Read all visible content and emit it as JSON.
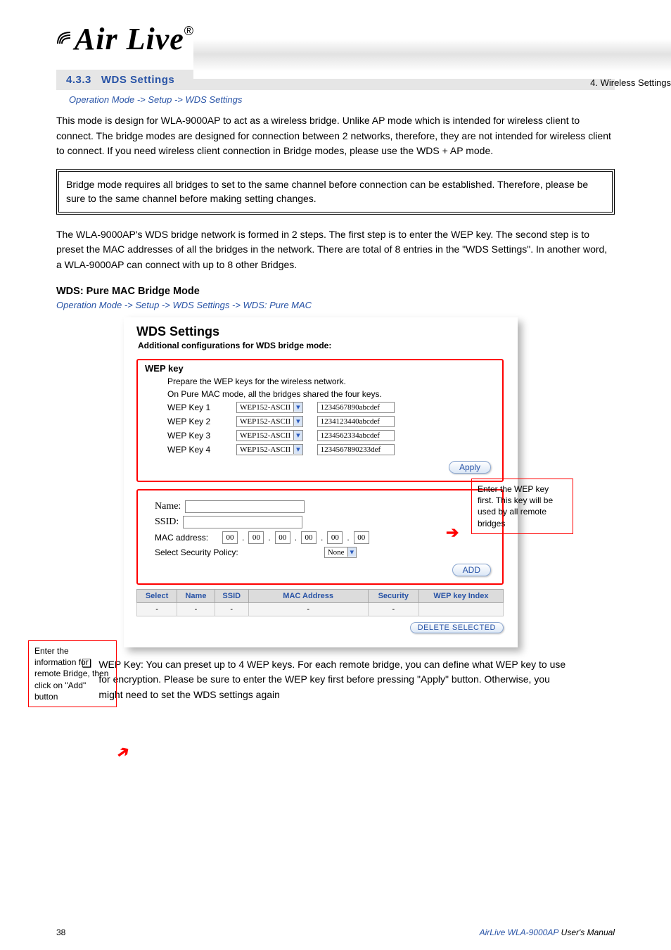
{
  "header": {
    "brand": "Air Live",
    "chapterRef": "4. Wireless Settings",
    "section_number": "4.3.3",
    "section_title": "WDS Settings",
    "crumb": "Operation Mode -> Setup -> WDS Settings"
  },
  "intro_p1": "This mode is design for WLA-9000AP to act as a wireless bridge. Unlike AP mode which is intended for wireless client to connect. The bridge modes are designed for connection between 2 networks, therefore, they are not intended for wireless client to connect. If you need wireless client connection in Bridge modes, please use the WDS + AP mode.",
  "box_text": "Bridge mode requires all bridges to set to the same channel before connection can be established. Therefore, please be sure to the same channel before making setting changes.",
  "intro_p2": "The WLA-9000AP's WDS bridge network is formed in 2 steps. The first step is to enter the WEP key. The second step is to preset the MAC addresses of all the bridges in the network. There are total of 8 entries in the \"WDS Settings\". In another word, a WLA-9000AP can connect with up to 8 other Bridges.",
  "subhead": "WDS: Pure MAC Bridge Mode",
  "subcrumb": "Operation Mode -> Setup -> WDS Settings -> WDS: Pure MAC",
  "wds_panel": {
    "title": "WDS Settings",
    "subline": "Additional configurations for WDS bridge mode:",
    "wep": {
      "heading": "WEP key",
      "desc1": "Prepare the WEP keys for the wireless network.",
      "desc2": "On Pure MAC mode, all the bridges shared the four keys.",
      "rows": [
        {
          "label": "WEP Key 1",
          "type": "WEP152-ASCII",
          "value": "1234567890abcdef"
        },
        {
          "label": "WEP Key 2",
          "type": "WEP152-ASCII",
          "value": "1234123440abcdef"
        },
        {
          "label": "WEP Key 3",
          "type": "WEP152-ASCII",
          "value": "1234562334abcdef"
        },
        {
          "label": "WEP Key 4",
          "type": "WEP152-ASCII",
          "value": "1234567890233def"
        }
      ],
      "apply": "Apply"
    },
    "add": {
      "name_label": "Name:",
      "ssid_label": "SSID:",
      "mac_label": "MAC address:",
      "mac": [
        "00",
        "00",
        "00",
        "00",
        "00",
        "00"
      ],
      "sec_label": "Select Security Policy:",
      "sec_value": "None",
      "add_btn": "ADD"
    },
    "table": {
      "headers": [
        "Select",
        "Name",
        "SSID",
        "MAC Address",
        "Security",
        "WEP key Index"
      ],
      "row": [
        "-",
        "-",
        "-",
        "-",
        "-",
        ""
      ]
    },
    "delete_btn": "DELETE SELECTED"
  },
  "callouts": {
    "right": "Enter the WEP key first. This key will be used by all remote bridges",
    "left": "Enter the information for remote Bridge, then click on \"Add\" button"
  },
  "after_para": "WEP Key: You can preset up to 4 WEP keys. For each remote bridge, you can define what WEP key to use for encryption. Please be sure to enter the WEP key first before pressing \"Apply\" button. Otherwise, you might need to set the WDS settings again",
  "footer": {
    "pagenum": "38",
    "prod": "AirLive WLA-9000AP",
    "ug": "User's Manual"
  }
}
